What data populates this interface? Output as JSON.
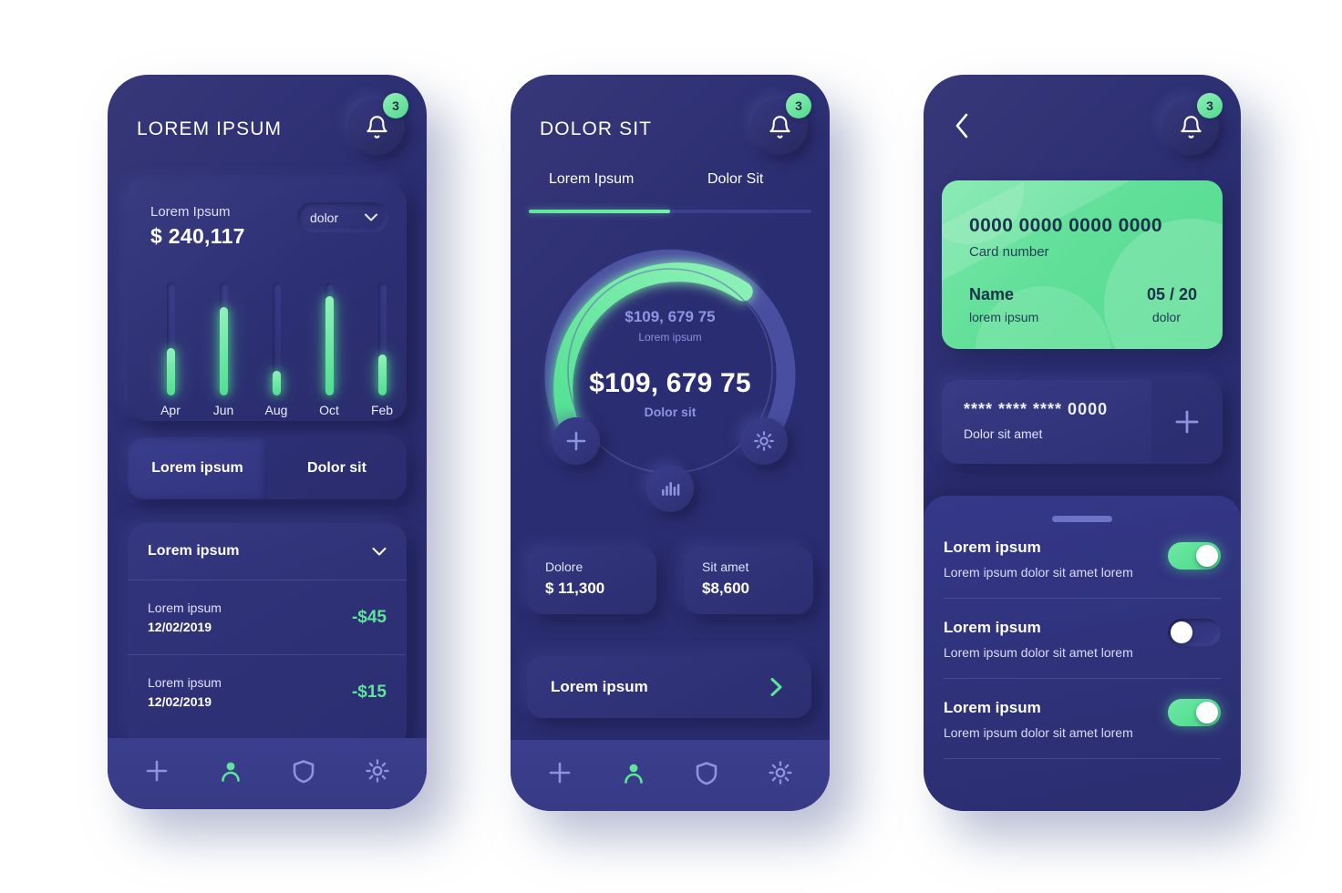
{
  "theme": {
    "page_bg": "#d8dcee",
    "phone_bg": "#2b2d72",
    "accent_green": "#5fe49a",
    "card_green": "#5fdf97",
    "muted_blue": "#8f96e0"
  },
  "screen1": {
    "title": "LOREM IPSUM",
    "bell_badge": "3",
    "balance_card": {
      "label": "Lorem Ipsum",
      "value": "$ 240,117",
      "dropdown": "dolor"
    },
    "chart_data": {
      "type": "bar",
      "title": "Lorem Ipsum",
      "categories": [
        "Apr",
        "Jun",
        "Aug",
        "Oct",
        "Feb"
      ],
      "values": [
        42,
        78,
        22,
        88,
        36
      ],
      "xlabel": "",
      "ylabel": "",
      "ylim": [
        0,
        100
      ],
      "grid": false,
      "legend": "none"
    },
    "segments": [
      {
        "label": "Lorem ipsum",
        "active": true
      },
      {
        "label": "Dolor sit",
        "active": false
      }
    ],
    "list": {
      "header": "Lorem ipsum",
      "rows": [
        {
          "title": "Lorem ipsum",
          "date": "12/02/2019",
          "amount": "-$45"
        },
        {
          "title": "Lorem ipsum",
          "date": "12/02/2019",
          "amount": "-$15"
        }
      ]
    },
    "nav": [
      {
        "icon": "plus-icon",
        "active": false
      },
      {
        "icon": "person-icon",
        "active": true
      },
      {
        "icon": "shield-icon",
        "active": false
      },
      {
        "icon": "gear-icon",
        "active": false
      }
    ]
  },
  "screen2": {
    "title": "DOLOR SIT",
    "bell_badge": "3",
    "tabs": [
      {
        "label": "Lorem Ipsum",
        "active": true
      },
      {
        "label": "Dolor Sit",
        "active": false
      }
    ],
    "chart_data": {
      "type": "pie",
      "subtype": "gauge",
      "title": "Dolor sit",
      "categories": [
        "filled",
        "remaining"
      ],
      "values": [
        60,
        40
      ],
      "value_label": "$109, 679 75",
      "secondary_label": "$109, 679 75",
      "secondary_caption": "Lorem ipsum",
      "caption": "Dolor sit",
      "arc_start_deg": 215,
      "arc_end_deg": 505,
      "colors": [
        "#5fe49a",
        "#4a4ea0"
      ]
    },
    "orbit_buttons": [
      {
        "icon": "plus-icon"
      },
      {
        "icon": "stats-icon"
      },
      {
        "icon": "gear-icon"
      }
    ],
    "stats": [
      {
        "label": "Dolore",
        "value": "$ 11,300"
      },
      {
        "label": "Sit amet",
        "value": "$8,600"
      }
    ],
    "cta": {
      "label": "Lorem ipsum",
      "icon": "chevron-right-icon"
    },
    "nav": [
      {
        "icon": "plus-icon",
        "active": false
      },
      {
        "icon": "person-icon",
        "active": true
      },
      {
        "icon": "shield-icon",
        "active": false
      },
      {
        "icon": "gear-icon",
        "active": false
      }
    ]
  },
  "screen3": {
    "back_icon": "chevron-left-icon",
    "bell_badge": "3",
    "credit_card": {
      "number": "0000 0000 0000 0000",
      "number_label": "Card number",
      "name": "Name",
      "name_label": "lorem ipsum",
      "expiry": "05 / 20",
      "expiry_label": "dolor"
    },
    "masked_card": {
      "number": "**** **** **** 0000",
      "label": "Dolor sit amet",
      "add_icon": "plus-icon"
    },
    "settings": [
      {
        "title": "Lorem ipsum",
        "desc": "Lorem ipsum dolor sit amet lorem",
        "on": true
      },
      {
        "title": "Lorem ipsum",
        "desc": "Lorem ipsum dolor sit amet lorem",
        "on": false
      },
      {
        "title": "Lorem ipsum",
        "desc": "Lorem ipsum dolor sit amet lorem",
        "on": true
      }
    ]
  }
}
